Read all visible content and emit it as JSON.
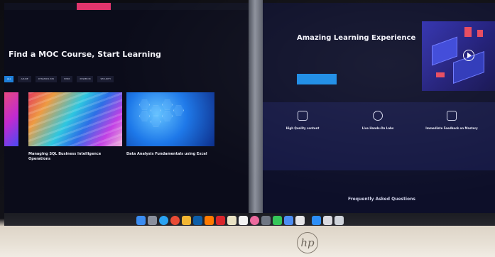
{
  "left_screen": {
    "title": "Find a MOC Course, Start Learning",
    "tabs": [
      {
        "label": "ALL",
        "active": true
      },
      {
        "label": "AZURE",
        "active": false
      },
      {
        "label": "DYNAMICS 365",
        "active": false
      },
      {
        "label": "M365",
        "active": false
      },
      {
        "label": "POWER BI",
        "active": false
      },
      {
        "label": "SECURITY",
        "active": false
      }
    ],
    "cards": [
      {
        "title": "Managing SQL Business Intelligence Operations"
      },
      {
        "title": "Data Analysis Fundamentals using Excel"
      }
    ]
  },
  "right_screen": {
    "hero_title": "Amazing Learning Experience",
    "features": [
      {
        "title": "High Quality content",
        "icon": "award-icon"
      },
      {
        "title": "Live Hands-On Labs",
        "icon": "globe-icon"
      },
      {
        "title": "Immediate Feedback on Mastery",
        "icon": "chat-icon"
      }
    ],
    "faq_title": "Frequently Asked Questions"
  },
  "brand": {
    "logo": "hp"
  },
  "colors": {
    "accent_blue": "#1a8be6",
    "background_navy": "#0d0f29",
    "pink": "#e0356c"
  },
  "dock_apps": [
    "finder",
    "launchpad",
    "safari",
    "chrome",
    "mail",
    "photoshop",
    "illustrator",
    "acrobat",
    "notes",
    "calendar",
    "photos",
    "settings",
    "messages",
    "trash"
  ]
}
